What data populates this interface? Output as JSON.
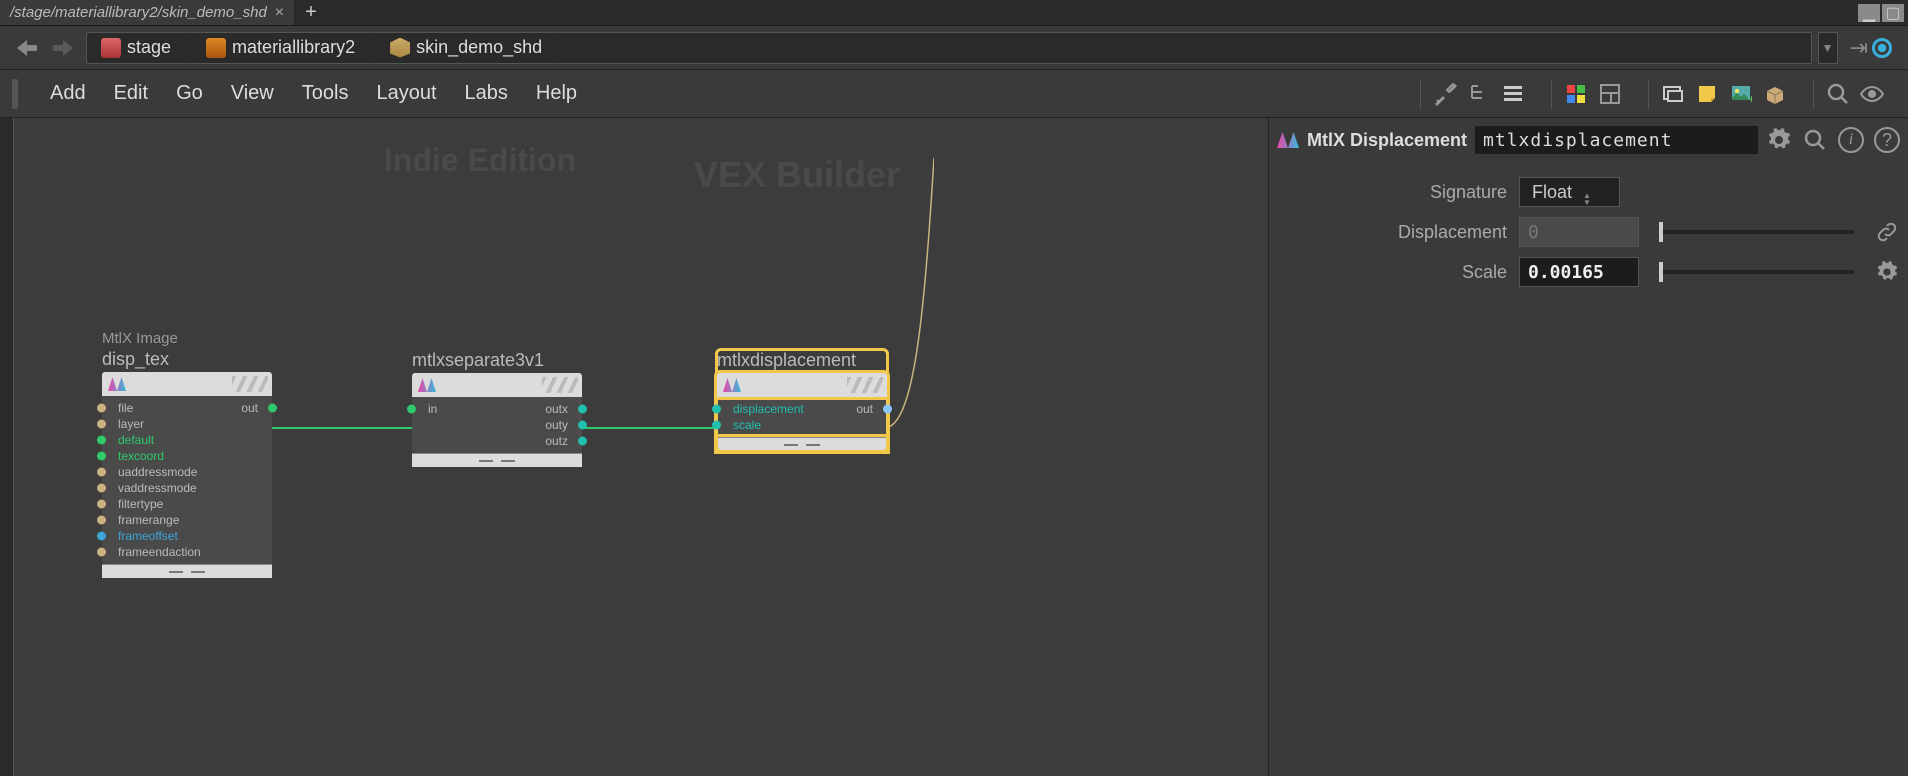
{
  "tab": {
    "path": "/stage/materiallibrary2/skin_demo_shd"
  },
  "breadcrumb": [
    {
      "label": "stage"
    },
    {
      "label": "materiallibrary2"
    },
    {
      "label": "skin_demo_shd"
    }
  ],
  "menu": [
    "Add",
    "Edit",
    "Go",
    "View",
    "Tools",
    "Layout",
    "Labs",
    "Help"
  ],
  "watermark": {
    "edition": "Indie Edition",
    "builder": "VEX Builder"
  },
  "nodes": {
    "disp_tex": {
      "type_label": "MtlX Image",
      "title": "disp_tex",
      "out_label": "out",
      "inputs": [
        {
          "name": "file",
          "color": "beige"
        },
        {
          "name": "layer",
          "color": "beige"
        },
        {
          "name": "default",
          "color": "green",
          "cls": "label-green"
        },
        {
          "name": "texcoord",
          "color": "green",
          "cls": "label-green"
        },
        {
          "name": "uaddressmode",
          "color": "beige"
        },
        {
          "name": "vaddressmode",
          "color": "beige"
        },
        {
          "name": "filtertype",
          "color": "beige"
        },
        {
          "name": "framerange",
          "color": "beige"
        },
        {
          "name": "frameoffset",
          "color": "blue",
          "cls": "label-blue"
        },
        {
          "name": "frameendaction",
          "color": "beige"
        }
      ]
    },
    "sep": {
      "title": "mtlxseparate3v1",
      "in_label": "in",
      "outputs": [
        "outx",
        "outy",
        "outz"
      ]
    },
    "disp": {
      "title": "mtlxdisplacement",
      "inputs": [
        "displacement",
        "scale"
      ],
      "out_label": "out"
    }
  },
  "panel": {
    "type_label": "MtlX Displacement",
    "name": "mtlxdisplacement",
    "params": {
      "signature": {
        "label": "Signature",
        "value": "Float"
      },
      "displacement": {
        "label": "Displacement",
        "value": "0"
      },
      "scale": {
        "label": "Scale",
        "value": "0.00165"
      }
    }
  }
}
